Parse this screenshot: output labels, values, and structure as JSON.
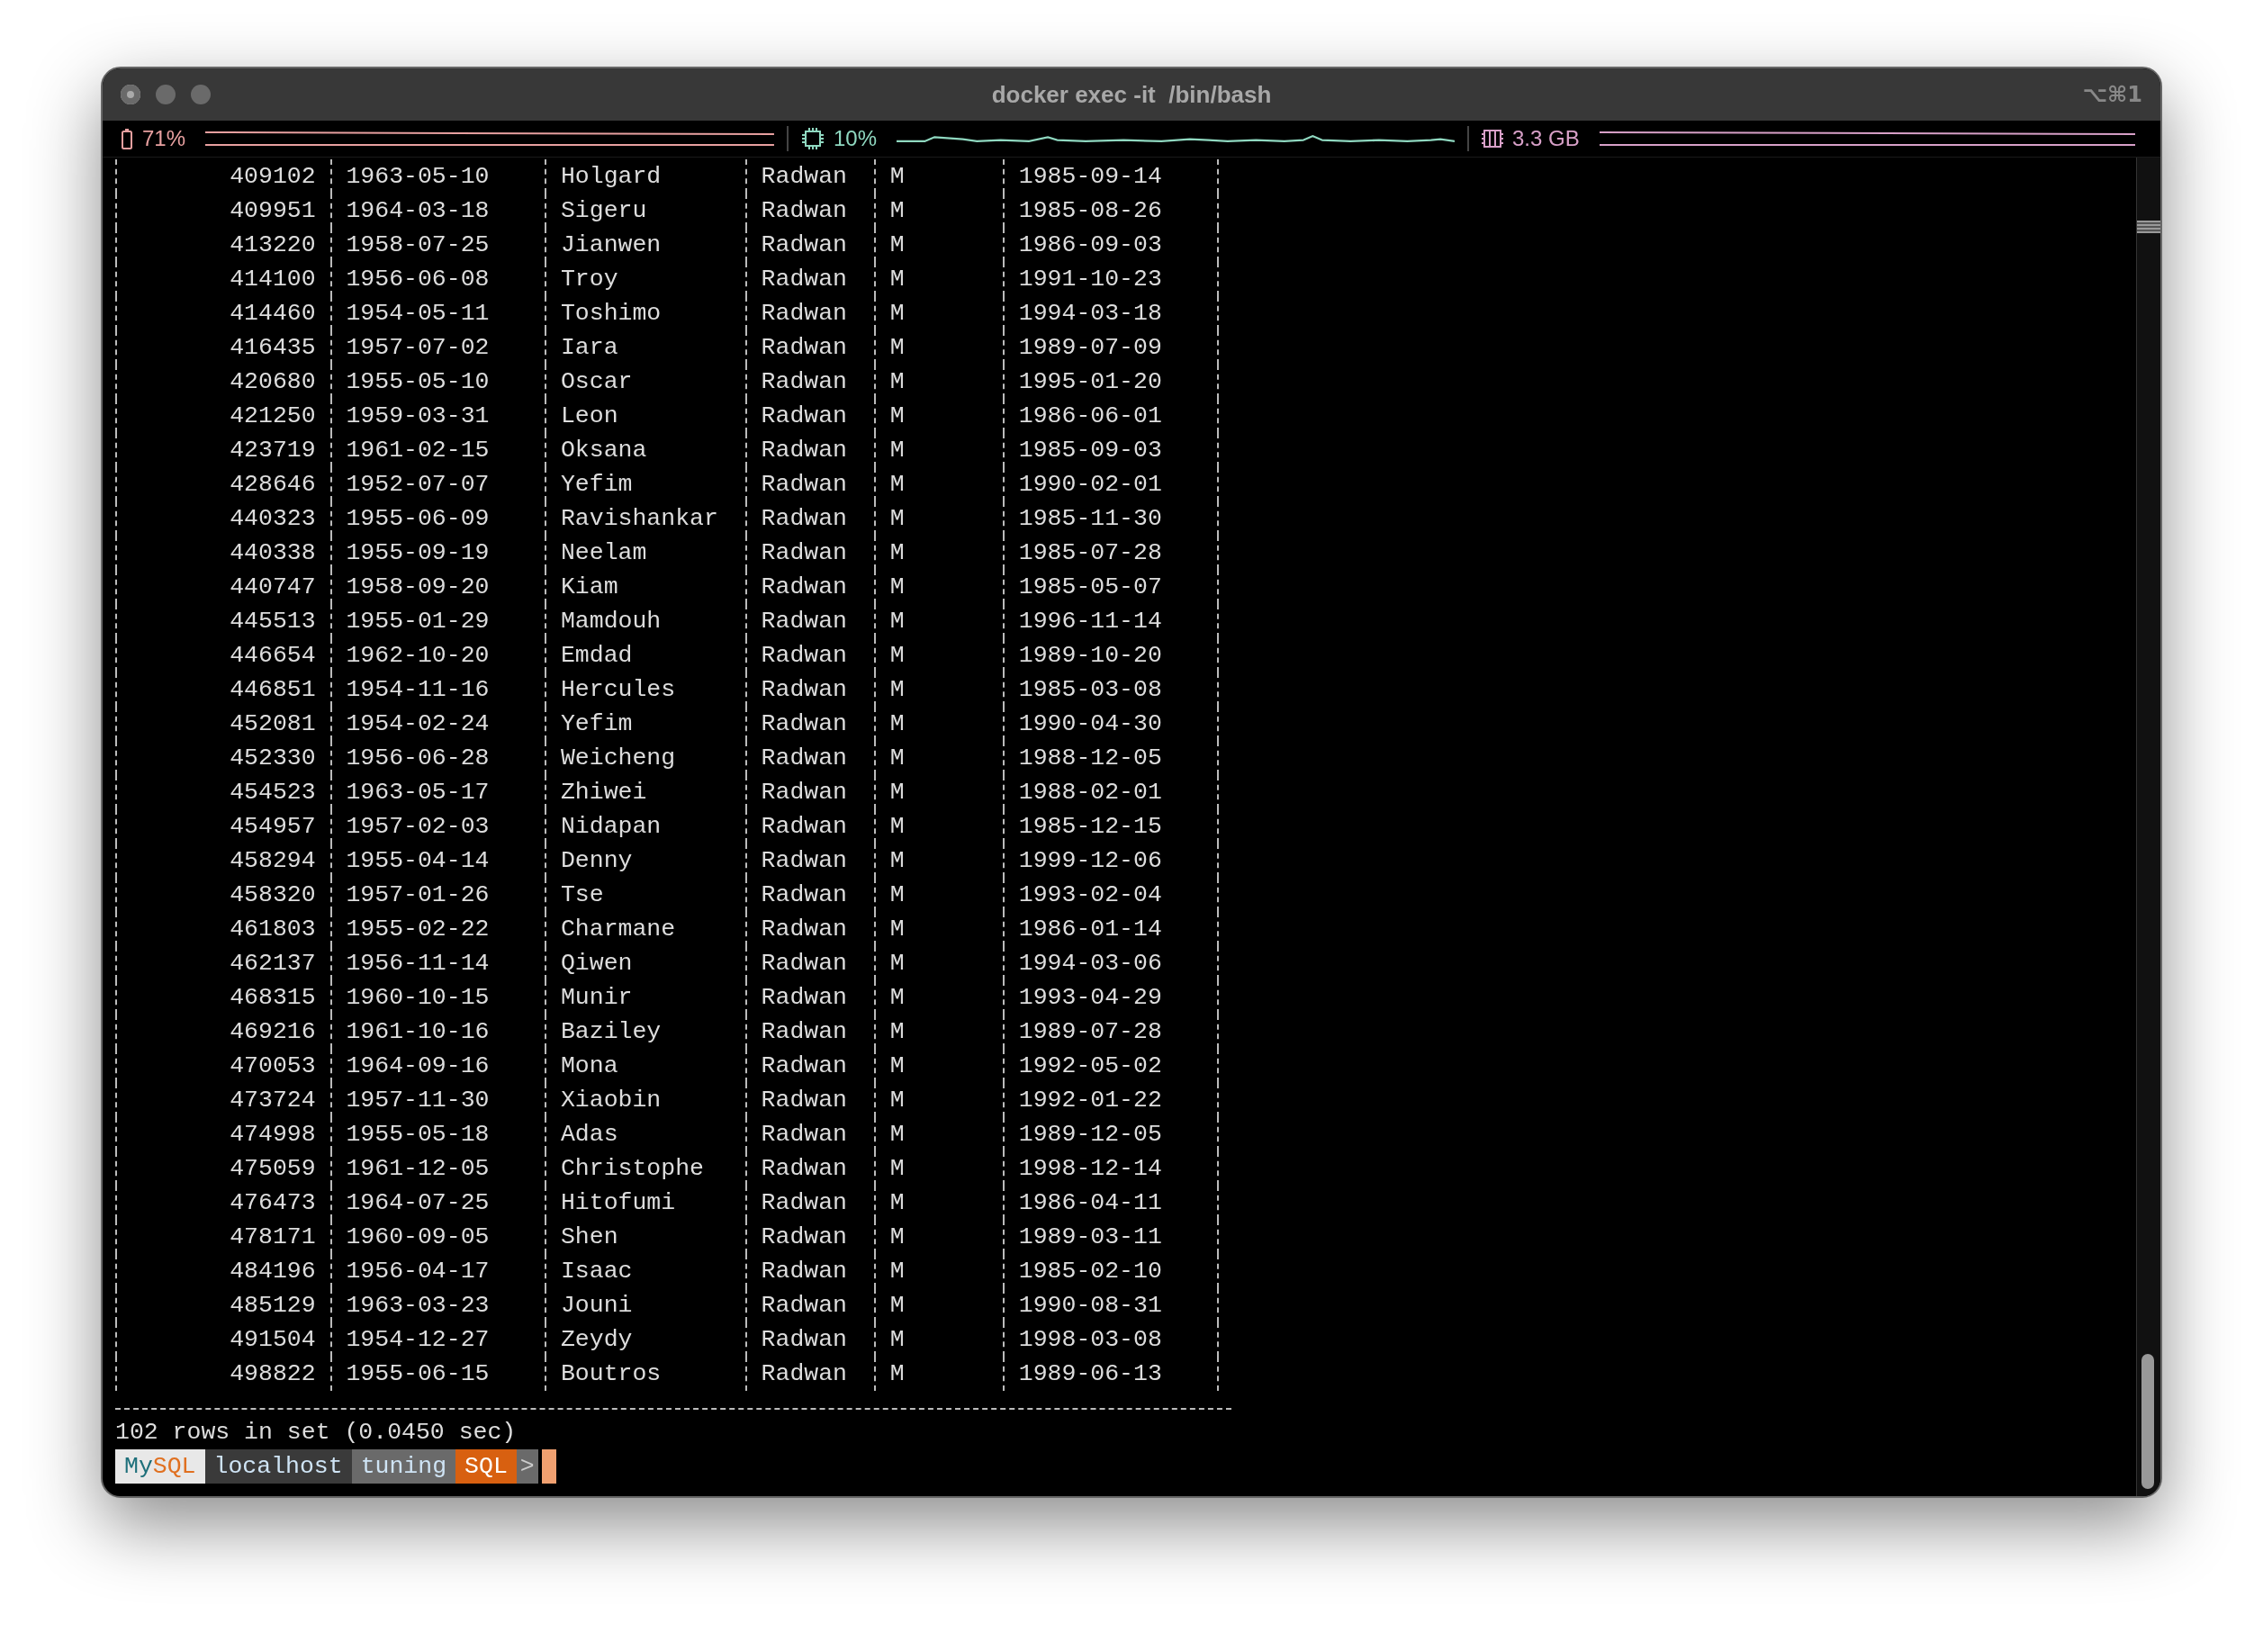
{
  "window": {
    "title": "docker exec -it  /bin/bash",
    "shortcut": "⌥⌘1"
  },
  "status_bar": [
    {
      "kind": "battery",
      "text": "71%",
      "color": "#e8a0a0"
    },
    {
      "kind": "cpu",
      "text": "10%",
      "color": "#8fd8c0"
    },
    {
      "kind": "memory",
      "text": "3.3 GB",
      "color": "#d8a0c8"
    }
  ],
  "table": {
    "rows": [
      [
        "409102",
        "1963-05-10",
        "Holgard",
        "Radwan",
        "M",
        "1985-09-14"
      ],
      [
        "409951",
        "1964-03-18",
        "Sigeru",
        "Radwan",
        "M",
        "1985-08-26"
      ],
      [
        "413220",
        "1958-07-25",
        "Jianwen",
        "Radwan",
        "M",
        "1986-09-03"
      ],
      [
        "414100",
        "1956-06-08",
        "Troy",
        "Radwan",
        "M",
        "1991-10-23"
      ],
      [
        "414460",
        "1954-05-11",
        "Toshimo",
        "Radwan",
        "M",
        "1994-03-18"
      ],
      [
        "416435",
        "1957-07-02",
        "Iara",
        "Radwan",
        "M",
        "1989-07-09"
      ],
      [
        "420680",
        "1955-05-10",
        "Oscar",
        "Radwan",
        "M",
        "1995-01-20"
      ],
      [
        "421250",
        "1959-03-31",
        "Leon",
        "Radwan",
        "M",
        "1986-06-01"
      ],
      [
        "423719",
        "1961-02-15",
        "Oksana",
        "Radwan",
        "M",
        "1985-09-03"
      ],
      [
        "428646",
        "1952-07-07",
        "Yefim",
        "Radwan",
        "M",
        "1990-02-01"
      ],
      [
        "440323",
        "1955-06-09",
        "Ravishankar",
        "Radwan",
        "M",
        "1985-11-30"
      ],
      [
        "440338",
        "1955-09-19",
        "Neelam",
        "Radwan",
        "M",
        "1985-07-28"
      ],
      [
        "440747",
        "1958-09-20",
        "Kiam",
        "Radwan",
        "M",
        "1985-05-07"
      ],
      [
        "445513",
        "1955-01-29",
        "Mamdouh",
        "Radwan",
        "M",
        "1996-11-14"
      ],
      [
        "446654",
        "1962-10-20",
        "Emdad",
        "Radwan",
        "M",
        "1989-10-20"
      ],
      [
        "446851",
        "1954-11-16",
        "Hercules",
        "Radwan",
        "M",
        "1985-03-08"
      ],
      [
        "452081",
        "1954-02-24",
        "Yefim",
        "Radwan",
        "M",
        "1990-04-30"
      ],
      [
        "452330",
        "1956-06-28",
        "Weicheng",
        "Radwan",
        "M",
        "1988-12-05"
      ],
      [
        "454523",
        "1963-05-17",
        "Zhiwei",
        "Radwan",
        "M",
        "1988-02-01"
      ],
      [
        "454957",
        "1957-02-03",
        "Nidapan",
        "Radwan",
        "M",
        "1985-12-15"
      ],
      [
        "458294",
        "1955-04-14",
        "Denny",
        "Radwan",
        "M",
        "1999-12-06"
      ],
      [
        "458320",
        "1957-01-26",
        "Tse",
        "Radwan",
        "M",
        "1993-02-04"
      ],
      [
        "461803",
        "1955-02-22",
        "Charmane",
        "Radwan",
        "M",
        "1986-01-14"
      ],
      [
        "462137",
        "1956-11-14",
        "Qiwen",
        "Radwan",
        "M",
        "1994-03-06"
      ],
      [
        "468315",
        "1960-10-15",
        "Munir",
        "Radwan",
        "M",
        "1993-04-29"
      ],
      [
        "469216",
        "1961-10-16",
        "Baziley",
        "Radwan",
        "M",
        "1989-07-28"
      ],
      [
        "470053",
        "1964-09-16",
        "Mona",
        "Radwan",
        "M",
        "1992-05-02"
      ],
      [
        "473724",
        "1957-11-30",
        "Xiaobin",
        "Radwan",
        "M",
        "1992-01-22"
      ],
      [
        "474998",
        "1955-05-18",
        "Adas",
        "Radwan",
        "M",
        "1989-12-05"
      ],
      [
        "475059",
        "1961-12-05",
        "Christophe",
        "Radwan",
        "M",
        "1998-12-14"
      ],
      [
        "476473",
        "1964-07-25",
        "Hitofumi",
        "Radwan",
        "M",
        "1986-04-11"
      ],
      [
        "478171",
        "1960-09-05",
        "Shen",
        "Radwan",
        "M",
        "1989-03-11"
      ],
      [
        "484196",
        "1956-04-17",
        "Isaac",
        "Radwan",
        "M",
        "1985-02-10"
      ],
      [
        "485129",
        "1963-03-23",
        "Jouni",
        "Radwan",
        "M",
        "1990-08-31"
      ],
      [
        "491504",
        "1954-12-27",
        "Zeydy",
        "Radwan",
        "M",
        "1998-03-08"
      ],
      [
        "498822",
        "1955-06-15",
        "Boutros",
        "Radwan",
        "M",
        "1989-06-13"
      ]
    ]
  },
  "result_line": "102 rows in set (0.0450 sec)",
  "prompt": {
    "segments": [
      {
        "kind": "logo",
        "parts": [
          {
            "text": "My",
            "color": "#1d6f7a"
          },
          {
            "text": "SQL",
            "color": "#e07020"
          }
        ]
      },
      {
        "kind": "host",
        "text": "localhost"
      },
      {
        "kind": "schema",
        "text": "tuning"
      },
      {
        "kind": "mode",
        "text": "SQL"
      }
    ],
    "arrow": ">"
  }
}
